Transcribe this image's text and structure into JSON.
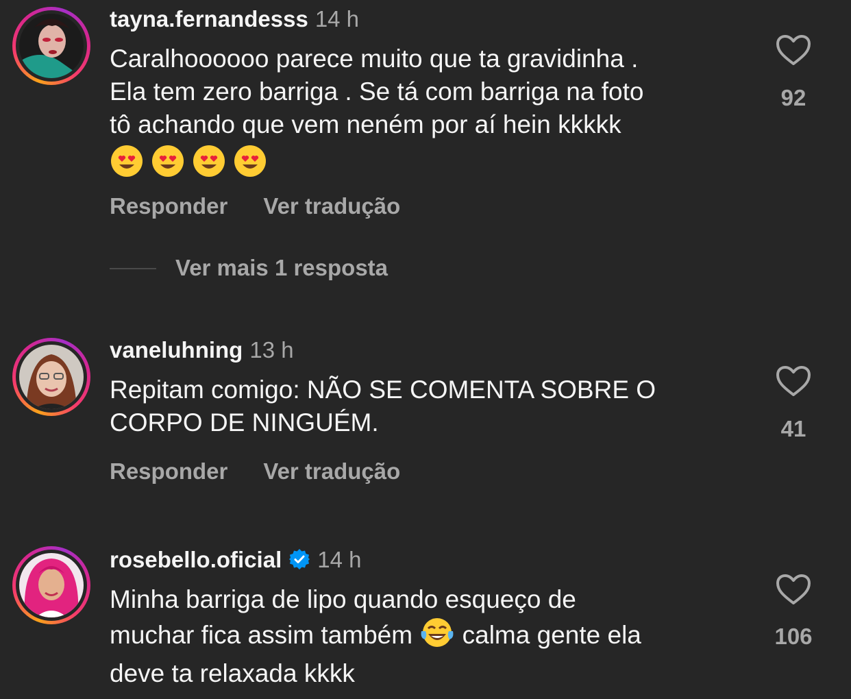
{
  "theme": {
    "background": "#262626",
    "text_primary": "#f5f5f5",
    "text_secondary": "#a8a8a8",
    "verified_blue": "#0095f6"
  },
  "comments": [
    {
      "username": "tayna.fernandesss",
      "time": "14 h",
      "verified": false,
      "text_lines": [
        "Caralhoooooo parece muito que ta gravidinha .",
        "Ela tem zero barriga . Se tá com barriga na foto",
        "tô achando que vem neném por aí hein kkkkk"
      ],
      "emojis": [
        "smiling-face-with-heart-eyes",
        "smiling-face-with-heart-eyes",
        "smiling-face-with-heart-eyes",
        "smiling-face-with-heart-eyes"
      ],
      "reply_label": "Responder",
      "translate_label": "Ver tradução",
      "likes": "92",
      "more_replies": "Ver mais 1 resposta"
    },
    {
      "username": "vaneluhning",
      "time": "13 h",
      "verified": false,
      "text_lines": [
        "Repitam comigo: NÃO SE COMENTA SOBRE O",
        "CORPO DE NINGUÉM."
      ],
      "reply_label": "Responder",
      "translate_label": "Ver tradução",
      "likes": "41"
    },
    {
      "username": "rosebello.oficial",
      "time": "14 h",
      "verified": true,
      "text_line1": "Minha barriga de lipo quando esqueço de",
      "text_line2_before": "muchar fica assim também ",
      "text_line2_emoji": "face-with-tears-of-joy",
      "text_line2_after": " calma gente ela",
      "text_line3": "deve ta relaxada kkkk",
      "likes": "106"
    }
  ]
}
